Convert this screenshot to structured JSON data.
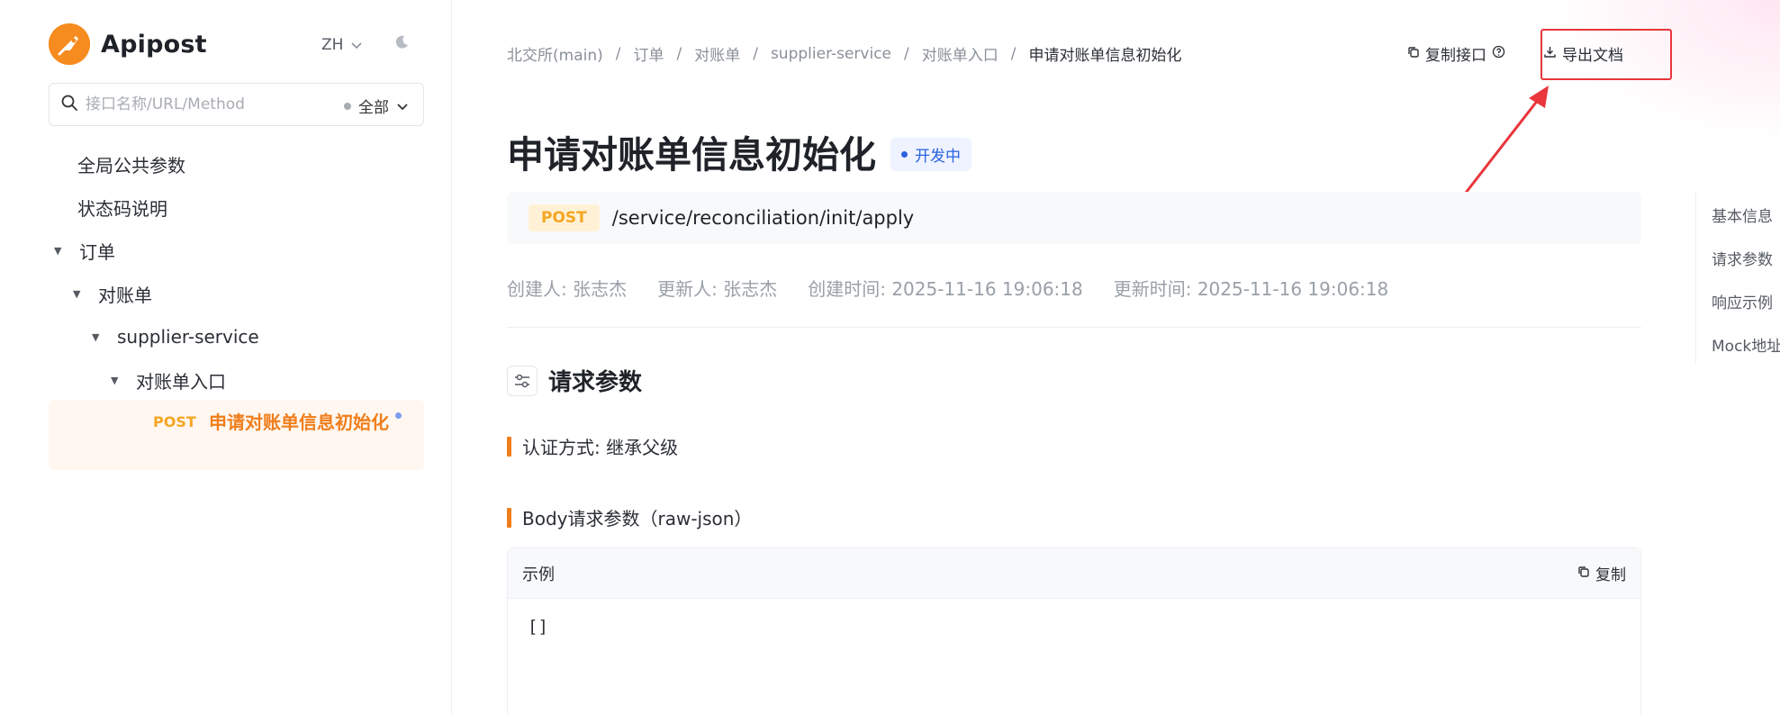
{
  "sidebar": {
    "brand": "Apipost",
    "lang": "ZH",
    "search_placeholder": "接口名称/URL/Method",
    "filter_label": "全部",
    "tree": [
      {
        "label": "全局公共参数"
      },
      {
        "label": "状态码说明"
      },
      {
        "label": "订单"
      },
      {
        "label": "对账单"
      },
      {
        "label": "supplier-service"
      },
      {
        "label": "对账单入口"
      }
    ],
    "active": {
      "method": "POST",
      "name": "申请对账单信息初始化"
    }
  },
  "breadcrumb": [
    "北交所(main)",
    "订单",
    "对账单",
    "supplier-service",
    "对账单入口",
    "申请对账单信息初始化"
  ],
  "actions": {
    "copy_api": "复制接口",
    "export_doc": "导出文档"
  },
  "page": {
    "title": "申请对账单信息初始化",
    "status": "开发中",
    "method": "POST",
    "url": "/service/reconciliation/init/apply",
    "meta": {
      "creator": "创建人: 张志杰",
      "updater": "更新人: 张志杰",
      "created": "创建时间: 2025-11-16 19:06:18",
      "updated": "更新时间: 2025-11-16 19:06:18"
    },
    "section_title": "请求参数",
    "auth": "认证方式: 继承父级",
    "body_label": "Body请求参数（raw-json）",
    "example_title": "示例",
    "copy_label": "复制",
    "code": "[]"
  },
  "anchor_nav": [
    "基本信息",
    "请求参数",
    "响应示例",
    "Mock地址"
  ],
  "colors": {
    "brand": "#f68b1f",
    "active_text": "#f07e1c",
    "method": "#f5a623",
    "status": "#2a61e0",
    "annotation": "#e8363c"
  }
}
